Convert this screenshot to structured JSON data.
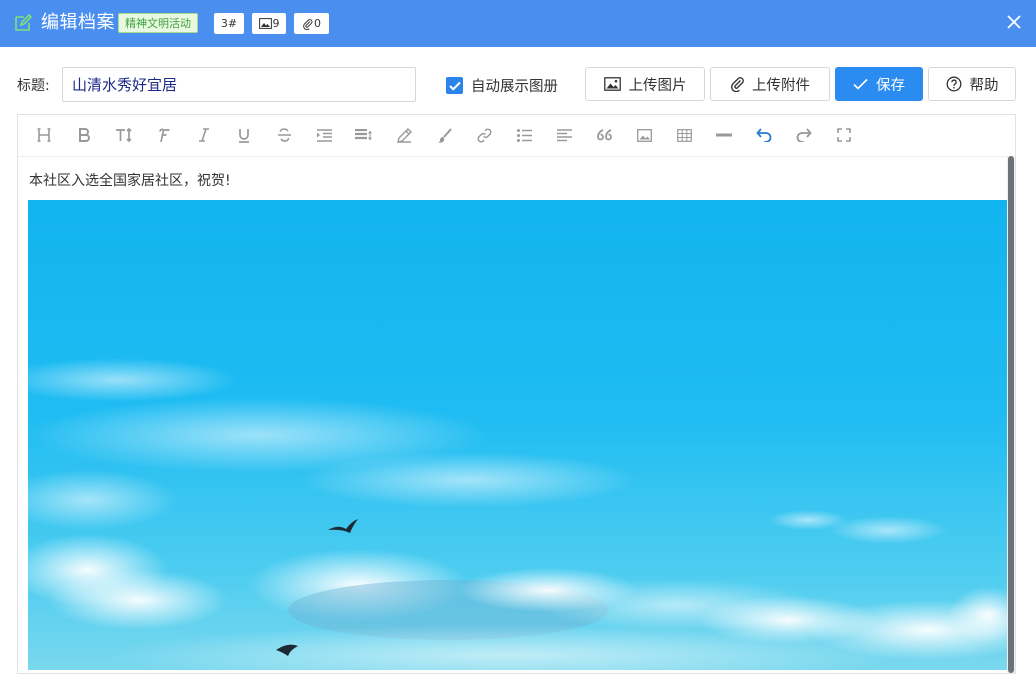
{
  "window": {
    "title": "编辑档案",
    "tag_category": "精神文明活动",
    "tag_number": "3#",
    "image_count": "9",
    "attachment_count": "0"
  },
  "form": {
    "title_label": "标题:",
    "title_value": "山清水秀好宜居",
    "auto_show_album_label": "自动展示图册",
    "auto_show_album_checked": true
  },
  "actions": {
    "upload_image": "上传图片",
    "upload_attachment": "上传附件",
    "save": "保存",
    "help": "帮助"
  },
  "toolbar": {
    "tools": [
      "heading",
      "bold",
      "text-size",
      "font",
      "italic",
      "underline",
      "strikethrough",
      "indent",
      "line-height",
      "pen",
      "brush",
      "link",
      "bulleted-list",
      "align",
      "quote",
      "image",
      "table",
      "horizontal-rule",
      "undo",
      "redo",
      "fullscreen"
    ]
  },
  "editor": {
    "paragraph": "本社区入选全国家居社区，祝贺!"
  },
  "colors": {
    "titlebar": "#4a8ef0",
    "primary": "#2a8cf0",
    "tag_green": "#3ea33e",
    "sky": "#16b6ef"
  }
}
